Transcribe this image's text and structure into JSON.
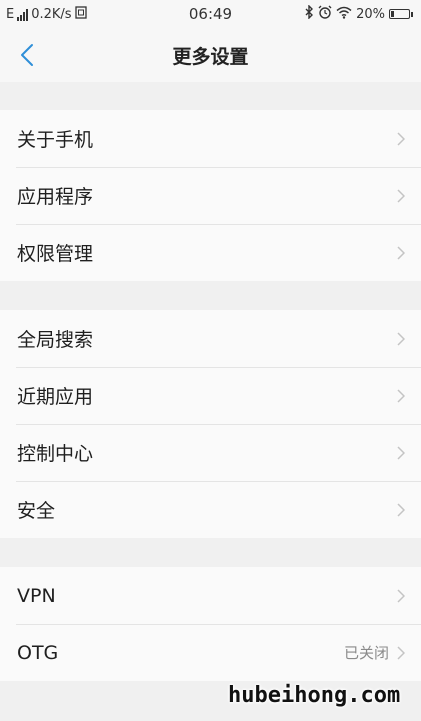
{
  "status_bar": {
    "network_type": "E",
    "speed": "0.2K/s",
    "time": "06:49",
    "battery": "20%",
    "battery_level": 0.2,
    "icons": [
      "signal-icon",
      "sim-icon",
      "bluetooth-icon",
      "alarm-icon",
      "wifi-icon",
      "battery-icon"
    ]
  },
  "header": {
    "title": "更多设置",
    "back_icon": "chevron-left-icon",
    "accent": "#2f8fd8"
  },
  "groups": [
    {
      "items": [
        {
          "label": "关于手机"
        },
        {
          "label": "应用程序"
        },
        {
          "label": "权限管理"
        }
      ]
    },
    {
      "items": [
        {
          "label": "全局搜索"
        },
        {
          "label": "近期应用"
        },
        {
          "label": "控制中心"
        },
        {
          "label": "安全"
        }
      ]
    },
    {
      "items": [
        {
          "label": "VPN"
        },
        {
          "label": "OTG",
          "value": "已关闭"
        }
      ]
    }
  ],
  "watermark": "hubeihong.com"
}
